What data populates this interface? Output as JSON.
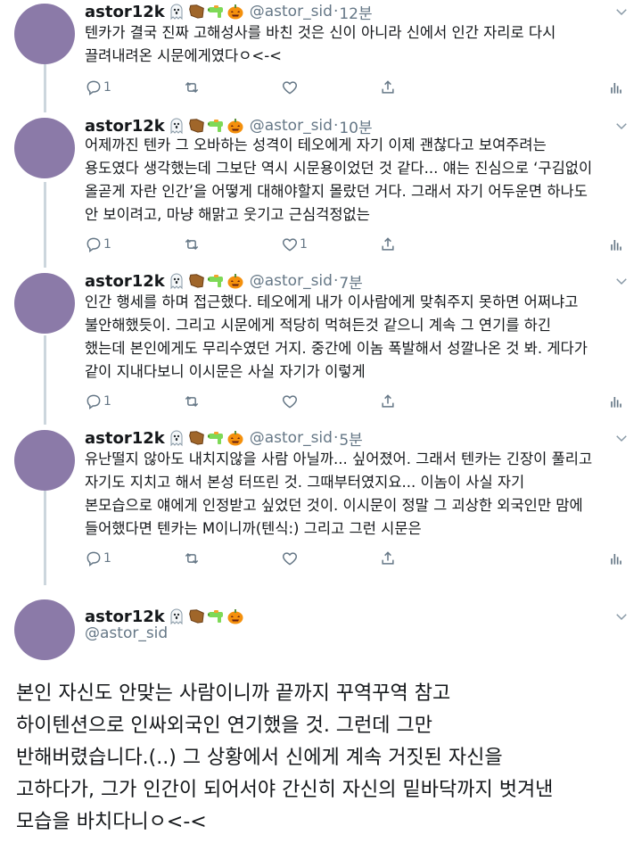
{
  "tweets": [
    {
      "name": "astor12k",
      "handle": "@astor_sid",
      "time": "12분",
      "lines": [
        "텐카가 결국 진짜 고해성사를 바친 것은 신이 아니라 신에서 인간 자리로 다시",
        "끌려내려온 시문에게였다ㅇ<-<"
      ],
      "reply_count": "1",
      "retweet_count": "",
      "like_count": ""
    },
    {
      "name": "astor12k",
      "handle": "@astor_sid",
      "time": "10분",
      "lines": [
        "어제까진 텐카 그 오바하는 성격이 테오에게 자기 이제 괜찮다고 보여주려는",
        "용도였다 생각했는데 그보단 역시 시문용이었던 것 같다... 얘는 진심으로 ‘구김없이",
        "올곧게 자란 인간’을 어떻게 대해야할지 몰랐던 거다. 그래서 자기 어두운면 하나도",
        "안 보이려고, 마냥 해맑고 웃기고 근심걱정없는"
      ],
      "reply_count": "1",
      "retweet_count": "",
      "like_count": "1"
    },
    {
      "name": "astor12k",
      "handle": "@astor_sid",
      "time": "7분",
      "lines": [
        "인간 행세를 하며 접근했다. 테오에게 내가 이사람에게 맞춰주지 못하면 어쩌냐고",
        "불안해했듯이. 그리고 시문에게 적당히 먹혀든것 같으니 계속 그 연기를 하긴",
        "했는데 본인에게도 무리수였던 거지. 중간에 이놈 폭발해서 성깔나온 것 봐. 게다가",
        "같이 지내다보니 이시문은 사실 자기가 이렇게"
      ],
      "reply_count": "1",
      "retweet_count": "",
      "like_count": ""
    },
    {
      "name": "astor12k",
      "handle": "@astor_sid",
      "time": "5분",
      "lines": [
        "유난떨지 않아도 내치지않을 사람 아닐까... 싶어졌어. 그래서 텐카는 긴장이 풀리고",
        "자기도 지치고 해서 본성 터뜨린 것. 그때부터였지요... 이놈이 사실 자기",
        "본모습으로 얘에게 인정받고 싶었던 것이. 이시문이 정말 그 괴상한 외국인만 맘에",
        "들어했다면 텐카는 M이니까(텐식:) 그리고 그런 시문은"
      ],
      "reply_count": "1",
      "retweet_count": "",
      "like_count": ""
    }
  ],
  "final_tweet": {
    "name": "astor12k",
    "handle": "@astor_sid",
    "lines": [
      "본인 자신도 안맞는 사람이니까 끝까지 꾸역꾸역 참고",
      "하이텐션으로 인싸외국인 연기했을 것. 그런데 그만",
      "반해버렸습니다.(..) 그 상황에서 신에게 계속 거짓된 자신을",
      "고하다가, 그가 인간이 되어서야 간신히 자신의 밑바닥까지 벗겨낸",
      "모습을 바치다니ㅇ<-<"
    ]
  },
  "icons": [
    "ghost-emoji",
    "coffin-emoji",
    "water-gun-emoji",
    "jack-o-lantern-emoji",
    "reply-icon",
    "retweet-icon",
    "like-icon",
    "share-icon",
    "analytics-icon",
    "chevron-down-icon"
  ],
  "colors": {
    "avatar": "#8b7aa8",
    "thread_line": "#ccd6dd",
    "secondary_text": "#657786"
  }
}
